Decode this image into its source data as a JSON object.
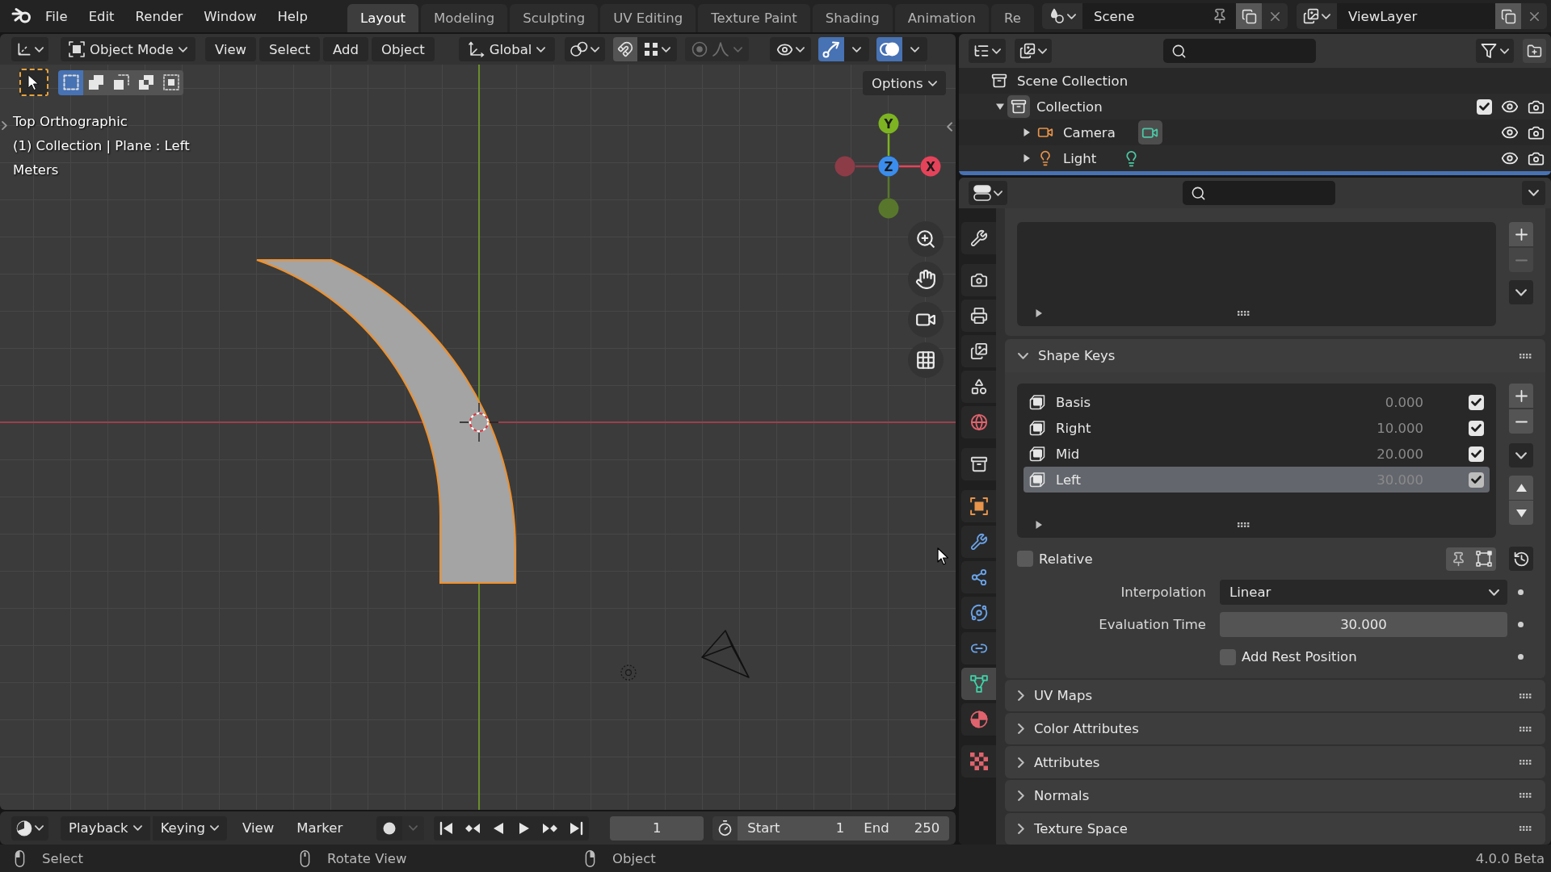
{
  "top_bar": {
    "menus": [
      "File",
      "Edit",
      "Render",
      "Window",
      "Help"
    ],
    "workspace_tabs": [
      {
        "label": "Layout",
        "selected": true
      },
      {
        "label": "Modeling",
        "selected": false
      },
      {
        "label": "Sculpting",
        "selected": false
      },
      {
        "label": "UV Editing",
        "selected": false
      },
      {
        "label": "Texture Paint",
        "selected": false
      },
      {
        "label": "Shading",
        "selected": false
      },
      {
        "label": "Animation",
        "selected": false
      },
      {
        "label": "Re",
        "selected": false
      }
    ],
    "scene": "Scene",
    "view_layer": "ViewLayer"
  },
  "viewport": {
    "header": {
      "mode": "Object Mode",
      "menus": [
        "View",
        "Select",
        "Add",
        "Object"
      ],
      "orientation": "Global",
      "toggles": [
        {
          "kind": "snap",
          "on": false
        },
        {
          "kind": "gizmos",
          "on": true
        },
        {
          "kind": "overlays",
          "on": true
        }
      ]
    },
    "select_modes": [
      {
        "kind": "new",
        "selected": true
      },
      {
        "kind": "extend",
        "selected": false
      },
      {
        "kind": "subtract",
        "selected": false
      },
      {
        "kind": "difference",
        "selected": false
      },
      {
        "kind": "intersect",
        "selected": false
      }
    ],
    "options": "Options",
    "info": [
      "Top Orthographic",
      "(1) Collection | Plane : Left",
      "Meters"
    ],
    "gizmo_axes": [
      {
        "label": "Y",
        "color": "#7db422"
      },
      {
        "color": "#8c3c47"
      },
      {
        "label": "Z",
        "color": "#3a8ded"
      },
      {
        "label": "X",
        "color": "#e5435a"
      },
      {
        "color": "#58772c"
      }
    ]
  },
  "outliner": {
    "tree": [
      {
        "name": "Scene Collection",
        "kind": "scene_collection",
        "active": false,
        "children": [
          {
            "name": "Collection",
            "kind": "collection",
            "expanded": true,
            "active": true,
            "checked": true,
            "children": [
              {
                "name": "Camera",
                "kind": "camera",
                "expanded": false,
                "active": false,
                "data_active": true
              },
              {
                "name": "Light",
                "kind": "light",
                "expanded": false,
                "active": false,
                "data_active": false
              }
            ]
          }
        ]
      }
    ]
  },
  "properties": {
    "tab_groups": [
      [
        {
          "kind": "tool",
          "selected": false
        }
      ],
      [
        {
          "kind": "render",
          "selected": false
        },
        {
          "kind": "output",
          "selected": false
        },
        {
          "kind": "view_layer",
          "selected": false
        },
        {
          "kind": "scene",
          "selected": false
        },
        {
          "kind": "world",
          "selected": false
        }
      ],
      [
        {
          "kind": "collection",
          "selected": false
        }
      ],
      [
        {
          "kind": "object",
          "selected": false
        },
        {
          "kind": "modifiers",
          "selected": false
        },
        {
          "kind": "particles",
          "selected": false
        },
        {
          "kind": "physics",
          "selected": false
        },
        {
          "kind": "constraints",
          "selected": false
        },
        {
          "kind": "data",
          "selected": true
        },
        {
          "kind": "material",
          "selected": false
        }
      ],
      [
        {
          "kind": "texture",
          "selected": false
        }
      ]
    ],
    "shape_keys": {
      "title": "Shape Keys",
      "expanded": true,
      "keys": [
        {
          "name": "Basis",
          "value": "0.000",
          "checked": true,
          "selected": false
        },
        {
          "name": "Right",
          "value": "10.000",
          "checked": true,
          "selected": false
        },
        {
          "name": "Mid",
          "value": "20.000",
          "checked": true,
          "selected": false
        },
        {
          "name": "Left",
          "value": "30.000",
          "checked": true,
          "selected": true
        }
      ],
      "relative": {
        "label": "Relative",
        "checked": false
      },
      "interpolation": {
        "label": "Interpolation",
        "value": "Linear"
      },
      "evaluation_time": {
        "label": "Evaluation Time",
        "value": "30.000"
      },
      "add_rest_position": {
        "label": "Add Rest Position",
        "checked": false
      }
    },
    "panels": [
      {
        "title": "UV Maps",
        "expanded": false
      },
      {
        "title": "Color Attributes",
        "expanded": false
      },
      {
        "title": "Attributes",
        "expanded": false
      },
      {
        "title": "Normals",
        "expanded": false
      },
      {
        "title": "Texture Space",
        "expanded": false
      }
    ]
  },
  "timeline": {
    "menus": [
      {
        "label": "Playback",
        "kind": "dropdown"
      },
      {
        "label": "Keying",
        "kind": "dropdown"
      },
      {
        "label": "View",
        "kind": "menu"
      },
      {
        "label": "Marker",
        "kind": "menu"
      }
    ],
    "current_frame": "1",
    "start": {
      "label": "Start",
      "value": "1"
    },
    "end": {
      "label": "End",
      "value": "250"
    }
  },
  "status_bar": {
    "hints": [
      {
        "kind": "left_click",
        "label": "Select"
      },
      {
        "kind": "middle_click",
        "label": "Rotate View"
      },
      {
        "kind": "right_click",
        "label": "Object"
      }
    ],
    "version": "4.0.0 Beta"
  }
}
